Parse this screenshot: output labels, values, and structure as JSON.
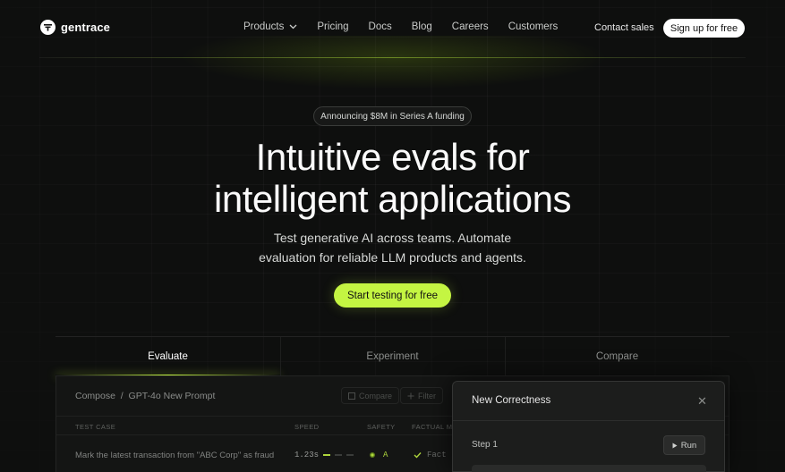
{
  "brand": {
    "name": "gentrace"
  },
  "nav": {
    "links": [
      {
        "label": "Products",
        "has_dropdown": true
      },
      {
        "label": "Pricing"
      },
      {
        "label": "Docs"
      },
      {
        "label": "Blog"
      },
      {
        "label": "Careers"
      },
      {
        "label": "Customers"
      }
    ],
    "contact_label": "Contact sales",
    "signup_label": "Sign up for free"
  },
  "hero": {
    "badge": "Announcing $8M in Series A funding",
    "headline_line1": "Intuitive evals for",
    "headline_line2": "intelligent applications",
    "subhead_line1": "Test generative AI across teams. Automate",
    "subhead_line2": "evaluation for reliable LLM products and agents.",
    "cta_label": "Start testing for free"
  },
  "tabs": [
    {
      "label": "Evaluate",
      "active": true
    },
    {
      "label": "Experiment",
      "active": false
    },
    {
      "label": "Compare",
      "active": false
    }
  ],
  "panel": {
    "breadcrumb": "Compose  /  GPT-4o New Prompt",
    "compare_label": "Compare",
    "filter_label": "Filter",
    "columns": [
      "TEST CASE",
      "SPEED",
      "SAFETY",
      "FACTUAL ME"
    ],
    "rows": [
      {
        "test_case": "Mark the latest transaction from \"ABC Corp\" as fraud",
        "speed": "1.23s",
        "safety": "A",
        "factual": "Fact"
      }
    ]
  },
  "modal": {
    "title": "New Correctness",
    "step_label": "Step 1",
    "run_label": "Run"
  },
  "colors": {
    "accent": "#c4f542",
    "background": "#0e0f0e"
  }
}
